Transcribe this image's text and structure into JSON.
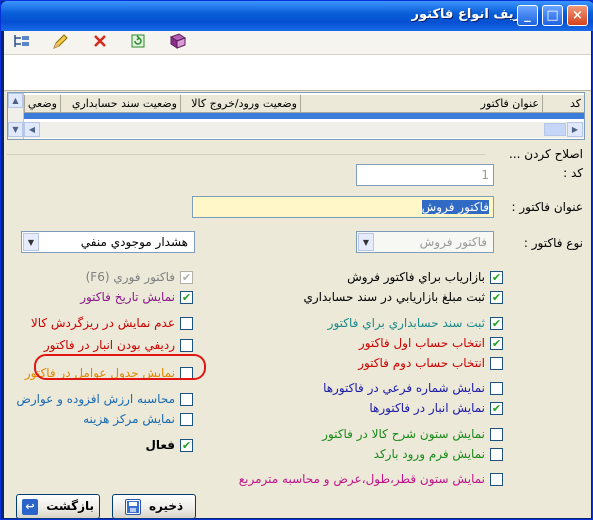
{
  "window": {
    "title": "تعريف انواع فاكتور"
  },
  "titlebar_buttons": {
    "close": "×",
    "maximize": "□",
    "minimize": "_"
  },
  "toolbar": {
    "icons": [
      "tree-icon",
      "pencil-icon",
      "delete-x-icon",
      "refresh-icon",
      "book-icon"
    ]
  },
  "grid": {
    "columns": [
      "كد",
      "عنوان فاكتور",
      "وضعيت ورود/خروج كالا",
      "وضعيت سند حسابداري",
      "وضعي"
    ]
  },
  "form": {
    "edit_caption": "اصلاح كردن ...",
    "code_label": "كد :",
    "code_value": "1",
    "title_label": "عنوان فاكتور :",
    "title_value": "فاكتور فروش",
    "type_label": "نوع فاكتور :",
    "type_value": "فاكتور فروش",
    "stock_warning_value": "هشدار موجودي منفي"
  },
  "right_checks": [
    {
      "label": "بازارياب براي فاكتور فروش",
      "checked": true,
      "color": "#000000"
    },
    {
      "label": "ثبت مبلغ بازاريابي در سند حسابداري",
      "checked": true,
      "color": "#000000"
    },
    {
      "label": "ثبت سند حسابداري براي فاكتور",
      "checked": true,
      "color": "#1a8a8a"
    },
    {
      "label": "انتخاب حساب اول فاكتور",
      "checked": true,
      "color": "#cc0000"
    },
    {
      "label": "انتخاب حساب دوم فاكتور",
      "checked": false,
      "color": "#cc0000"
    },
    {
      "label": "نمايش شماره فرعي در فاكتورها",
      "checked": false,
      "color": "#1a1aa8"
    },
    {
      "label": "نمايش انبار در فاكتورها",
      "checked": true,
      "color": "#1a1aa8"
    },
    {
      "label": "نمايش ستون شرح كالا در فاكتور",
      "checked": false,
      "color": "#1a8a1a"
    },
    {
      "label": "نمايش فرم ورود باركد",
      "checked": false,
      "color": "#1a8a1a"
    },
    {
      "label": "نمايش ستون قطر،طول،عرض و محاسبه مترمربع",
      "checked": false,
      "color": "#c0148a"
    }
  ],
  "left_checks": [
    {
      "label": "فاكتور فوري (F6)",
      "checked": true,
      "color": "#808080"
    },
    {
      "label": "نمايش تاريخ فاكتور",
      "checked": true,
      "color": "#8a1a8a"
    },
    {
      "label": "عدم نمايش در ريزگردش كالا",
      "checked": false,
      "color": "#cc0000"
    },
    {
      "label": "رديفي بودن انبار در فاكتور",
      "checked": false,
      "color": "#cc0000"
    },
    {
      "label": "نمايش جدول عوامل در فاكتور",
      "checked": false,
      "color": "#e08a00"
    },
    {
      "label": "محاسبه ارزش افزوده و عوارض",
      "checked": false,
      "color": "#1a6ab0"
    },
    {
      "label": "نمايش مركز هزينه",
      "checked": false,
      "color": "#1a6ab0"
    },
    {
      "label": "فعال",
      "checked": true,
      "color": "#000000"
    }
  ],
  "buttons": {
    "save": "ذخيره",
    "back": "بازگشت"
  },
  "colors": {
    "titlebar": "#0a5fd8",
    "selection": "#3b7bd9",
    "highlight_oval": "#e21515",
    "title_field_bg": "#fff7c8"
  }
}
